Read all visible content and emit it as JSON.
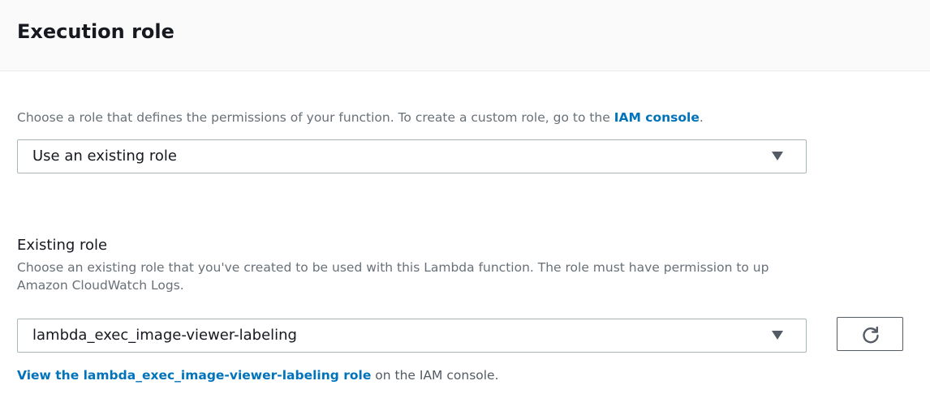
{
  "header": {
    "title": "Execution role"
  },
  "role_selector": {
    "description_prefix": "Choose a role that defines the permissions of your function. To create a custom role, go to the ",
    "iam_console_link": "IAM console",
    "description_suffix": ".",
    "selected_value": "Use an existing role"
  },
  "existing_role": {
    "label": "Existing role",
    "description_line1": "Choose an existing role that you've created to be used with this Lambda function. The role must have permission to up",
    "description_line2": "Amazon CloudWatch Logs.",
    "selected_value": "lambda_exec_image-viewer-labeling",
    "refresh_icon": "refresh-icon",
    "view_link": "View the lambda_exec_image-viewer-labeling role",
    "view_suffix": " on the IAM console."
  },
  "colors": {
    "link": "#0073bb",
    "header_bg": "#fafafa",
    "muted_text": "#687078"
  }
}
